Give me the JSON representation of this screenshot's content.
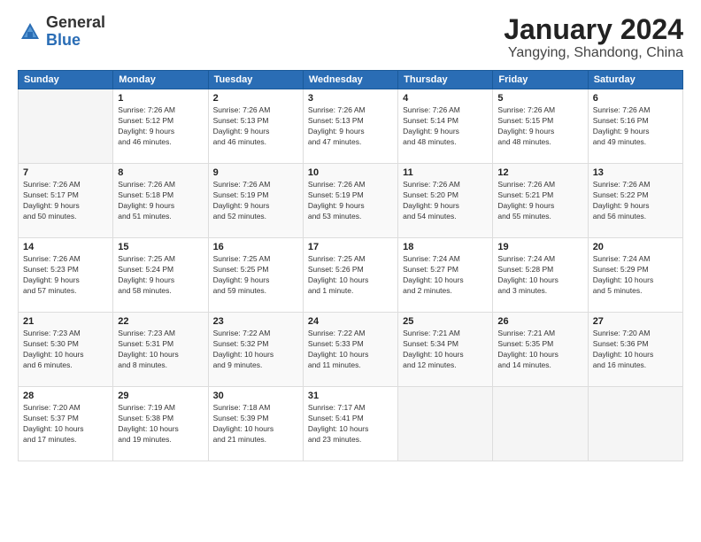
{
  "logo": {
    "general": "General",
    "blue": "Blue"
  },
  "title": "January 2024",
  "location": "Yangying, Shandong, China",
  "days_of_week": [
    "Sunday",
    "Monday",
    "Tuesday",
    "Wednesday",
    "Thursday",
    "Friday",
    "Saturday"
  ],
  "weeks": [
    [
      {
        "day": "",
        "info": ""
      },
      {
        "day": "1",
        "info": "Sunrise: 7:26 AM\nSunset: 5:12 PM\nDaylight: 9 hours\nand 46 minutes."
      },
      {
        "day": "2",
        "info": "Sunrise: 7:26 AM\nSunset: 5:13 PM\nDaylight: 9 hours\nand 46 minutes."
      },
      {
        "day": "3",
        "info": "Sunrise: 7:26 AM\nSunset: 5:13 PM\nDaylight: 9 hours\nand 47 minutes."
      },
      {
        "day": "4",
        "info": "Sunrise: 7:26 AM\nSunset: 5:14 PM\nDaylight: 9 hours\nand 48 minutes."
      },
      {
        "day": "5",
        "info": "Sunrise: 7:26 AM\nSunset: 5:15 PM\nDaylight: 9 hours\nand 48 minutes."
      },
      {
        "day": "6",
        "info": "Sunrise: 7:26 AM\nSunset: 5:16 PM\nDaylight: 9 hours\nand 49 minutes."
      }
    ],
    [
      {
        "day": "7",
        "info": "Sunrise: 7:26 AM\nSunset: 5:17 PM\nDaylight: 9 hours\nand 50 minutes."
      },
      {
        "day": "8",
        "info": "Sunrise: 7:26 AM\nSunset: 5:18 PM\nDaylight: 9 hours\nand 51 minutes."
      },
      {
        "day": "9",
        "info": "Sunrise: 7:26 AM\nSunset: 5:19 PM\nDaylight: 9 hours\nand 52 minutes."
      },
      {
        "day": "10",
        "info": "Sunrise: 7:26 AM\nSunset: 5:19 PM\nDaylight: 9 hours\nand 53 minutes."
      },
      {
        "day": "11",
        "info": "Sunrise: 7:26 AM\nSunset: 5:20 PM\nDaylight: 9 hours\nand 54 minutes."
      },
      {
        "day": "12",
        "info": "Sunrise: 7:26 AM\nSunset: 5:21 PM\nDaylight: 9 hours\nand 55 minutes."
      },
      {
        "day": "13",
        "info": "Sunrise: 7:26 AM\nSunset: 5:22 PM\nDaylight: 9 hours\nand 56 minutes."
      }
    ],
    [
      {
        "day": "14",
        "info": "Sunrise: 7:26 AM\nSunset: 5:23 PM\nDaylight: 9 hours\nand 57 minutes."
      },
      {
        "day": "15",
        "info": "Sunrise: 7:25 AM\nSunset: 5:24 PM\nDaylight: 9 hours\nand 58 minutes."
      },
      {
        "day": "16",
        "info": "Sunrise: 7:25 AM\nSunset: 5:25 PM\nDaylight: 9 hours\nand 59 minutes."
      },
      {
        "day": "17",
        "info": "Sunrise: 7:25 AM\nSunset: 5:26 PM\nDaylight: 10 hours\nand 1 minute."
      },
      {
        "day": "18",
        "info": "Sunrise: 7:24 AM\nSunset: 5:27 PM\nDaylight: 10 hours\nand 2 minutes."
      },
      {
        "day": "19",
        "info": "Sunrise: 7:24 AM\nSunset: 5:28 PM\nDaylight: 10 hours\nand 3 minutes."
      },
      {
        "day": "20",
        "info": "Sunrise: 7:24 AM\nSunset: 5:29 PM\nDaylight: 10 hours\nand 5 minutes."
      }
    ],
    [
      {
        "day": "21",
        "info": "Sunrise: 7:23 AM\nSunset: 5:30 PM\nDaylight: 10 hours\nand 6 minutes."
      },
      {
        "day": "22",
        "info": "Sunrise: 7:23 AM\nSunset: 5:31 PM\nDaylight: 10 hours\nand 8 minutes."
      },
      {
        "day": "23",
        "info": "Sunrise: 7:22 AM\nSunset: 5:32 PM\nDaylight: 10 hours\nand 9 minutes."
      },
      {
        "day": "24",
        "info": "Sunrise: 7:22 AM\nSunset: 5:33 PM\nDaylight: 10 hours\nand 11 minutes."
      },
      {
        "day": "25",
        "info": "Sunrise: 7:21 AM\nSunset: 5:34 PM\nDaylight: 10 hours\nand 12 minutes."
      },
      {
        "day": "26",
        "info": "Sunrise: 7:21 AM\nSunset: 5:35 PM\nDaylight: 10 hours\nand 14 minutes."
      },
      {
        "day": "27",
        "info": "Sunrise: 7:20 AM\nSunset: 5:36 PM\nDaylight: 10 hours\nand 16 minutes."
      }
    ],
    [
      {
        "day": "28",
        "info": "Sunrise: 7:20 AM\nSunset: 5:37 PM\nDaylight: 10 hours\nand 17 minutes."
      },
      {
        "day": "29",
        "info": "Sunrise: 7:19 AM\nSunset: 5:38 PM\nDaylight: 10 hours\nand 19 minutes."
      },
      {
        "day": "30",
        "info": "Sunrise: 7:18 AM\nSunset: 5:39 PM\nDaylight: 10 hours\nand 21 minutes."
      },
      {
        "day": "31",
        "info": "Sunrise: 7:17 AM\nSunset: 5:41 PM\nDaylight: 10 hours\nand 23 minutes."
      },
      {
        "day": "",
        "info": ""
      },
      {
        "day": "",
        "info": ""
      },
      {
        "day": "",
        "info": ""
      }
    ]
  ]
}
